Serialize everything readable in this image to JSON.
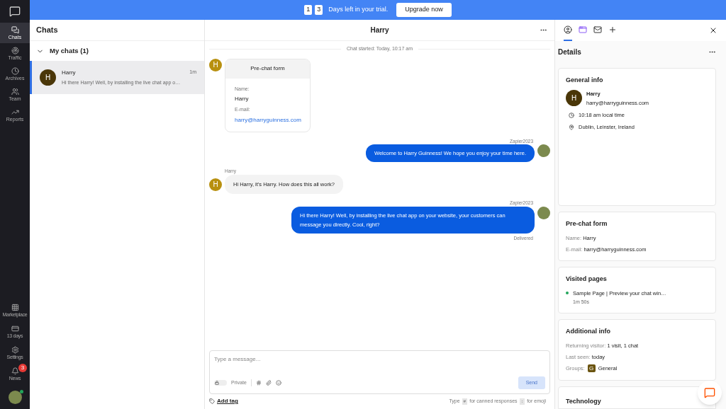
{
  "trial_banner": {
    "digits": [
      "1",
      "3"
    ],
    "text": "Days left in your trial.",
    "button": "Upgrade now"
  },
  "nav": {
    "top": [
      {
        "kind": "chats",
        "label": "Chats",
        "selected": true
      },
      {
        "kind": "traffic",
        "label": "Traffic",
        "selected": false
      },
      {
        "kind": "archives",
        "label": "Archives",
        "selected": false
      },
      {
        "kind": "team",
        "label": "Team",
        "selected": false
      },
      {
        "kind": "reports",
        "label": "Reports",
        "selected": false
      }
    ],
    "bottom": [
      {
        "kind": "marketplace",
        "label": "Marketplace"
      },
      {
        "kind": "billing",
        "label": "13 days"
      },
      {
        "kind": "settings",
        "label": "Settings"
      },
      {
        "kind": "news",
        "label": "News",
        "badge": "3"
      }
    ]
  },
  "chat_list": {
    "title": "Chats",
    "group": {
      "label": "My chats (1)",
      "expanded": true
    },
    "items": [
      {
        "initial": "H",
        "name": "Harry",
        "time": "1m",
        "preview": "Hi there Harry! Well, by installing the live chat app o…",
        "selected": true
      }
    ]
  },
  "conversation": {
    "title": "Harry",
    "started": "Chat started: Today, 10:17 am",
    "messages": [
      {
        "kind": "form",
        "initial": "H",
        "title": "Pre-chat form",
        "fields": [
          {
            "label": "Name:",
            "value": "Harry"
          },
          {
            "label": "E-mail:",
            "value": "harry@harryguinness.com"
          }
        ]
      },
      {
        "kind": "agent",
        "author": "Zapier2023",
        "text": "Welcome to Harry Guinness! We hope you enjoy your time here."
      },
      {
        "kind": "visitor",
        "author": "Harry",
        "initial": "H",
        "text": "Hi Harry, it's Harry. How does this all work?"
      },
      {
        "kind": "agent",
        "author": "Zapier2023",
        "text": "Hi there Harry! Well, by installing the live chat app on your website, your customers can message you directly. Cool, right?",
        "status": "Delivered"
      }
    ]
  },
  "composer": {
    "placeholder": "Type a message...",
    "private_label": "Private",
    "private": false,
    "send": "Send",
    "add_tag": "Add tag",
    "hint": [
      "Type",
      "#",
      "for canned responses",
      ":",
      "for emoji"
    ]
  },
  "details": {
    "tabs": [
      {
        "kind": "customer",
        "selected": true
      },
      {
        "kind": "apps",
        "selected": false
      },
      {
        "kind": "mail",
        "selected": false
      },
      {
        "kind": "add",
        "selected": false
      }
    ],
    "title": "Details",
    "general": {
      "title": "General info",
      "initial": "H",
      "name": "Harry",
      "email": "harry@harryguinness.com",
      "local_time": "10:18 am local time",
      "location": "Dublin, Leinster, Ireland"
    },
    "prechat": {
      "title": "Pre-chat form",
      "rows": [
        {
          "label": "Name:",
          "value": "Harry"
        },
        {
          "label": "E-mail:",
          "value": "harry@harryguinness.com"
        }
      ]
    },
    "visited": {
      "title": "Visited pages",
      "pages": [
        {
          "title": "Sample Page | Preview your chat win…",
          "duration": "1m 50s"
        }
      ]
    },
    "additional": {
      "title": "Additional info",
      "rows": [
        {
          "label": "Returning visitor:",
          "value": "1 visit, 1 chat"
        },
        {
          "label": "Last seen:",
          "value": "today"
        }
      ],
      "groups_label": "Groups:",
      "group": {
        "initial": "G",
        "name": "General"
      }
    },
    "technology": {
      "title": "Technology"
    }
  }
}
